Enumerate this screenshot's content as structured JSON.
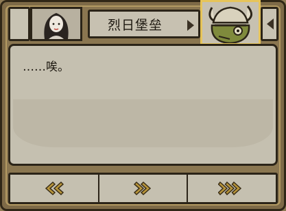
{
  "header": {
    "title": "烈日堡垒"
  },
  "dialog": {
    "text": "……唉。"
  },
  "controls": {
    "rewind_icon": "double-chevron-left-icon",
    "next_icon": "double-chevron-right-icon",
    "skip_icon": "fast-forward-icon"
  },
  "colors": {
    "frame": "#7e6a47",
    "panel": "#c5c0b0",
    "border": "#2b2418",
    "highlight": "#e6c45a",
    "arrow_fill": "#b8953a"
  }
}
